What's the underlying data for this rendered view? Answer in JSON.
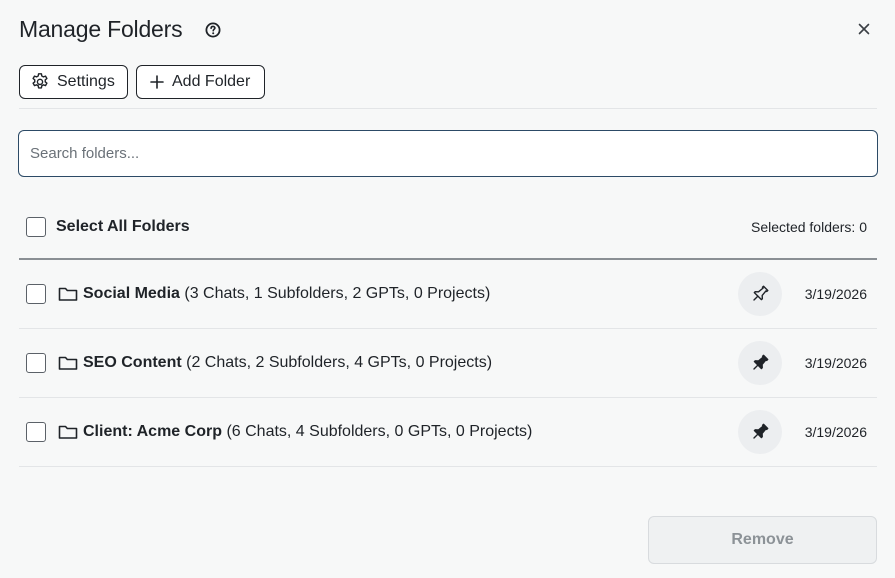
{
  "header": {
    "title": "Manage Folders",
    "help_icon": "question-circle-icon",
    "close_icon": "close-icon"
  },
  "toolbar": {
    "settings_label": "Settings",
    "settings_icon": "gear-icon",
    "add_folder_label": "Add Folder",
    "add_folder_icon": "plus-icon"
  },
  "search": {
    "placeholder": "Search folders...",
    "value": ""
  },
  "selection": {
    "select_all_label": "Select All Folders",
    "selected_count_text": "Selected folders: 0"
  },
  "folders": [
    {
      "name": "Social Media",
      "details": "(3 Chats, 1 Subfolders, 2 GPTs, 0 Projects)",
      "date": "3/19/2026",
      "pinned": false,
      "checked": false
    },
    {
      "name": "SEO Content",
      "details": "(2 Chats, 2 Subfolders, 4 GPTs, 0 Projects)",
      "date": "3/19/2026",
      "pinned": true,
      "checked": false
    },
    {
      "name": "Client: Acme Corp",
      "details": "(6 Chats, 4 Subfolders, 0 GPTs, 0 Projects)",
      "date": "3/19/2026",
      "pinned": true,
      "checked": false
    }
  ],
  "footer": {
    "remove_label": "Remove"
  },
  "colors": {
    "background": "#f7f8f8",
    "text": "#1f2328",
    "search_border": "#2c4a66",
    "disabled_text": "#8c9297"
  }
}
